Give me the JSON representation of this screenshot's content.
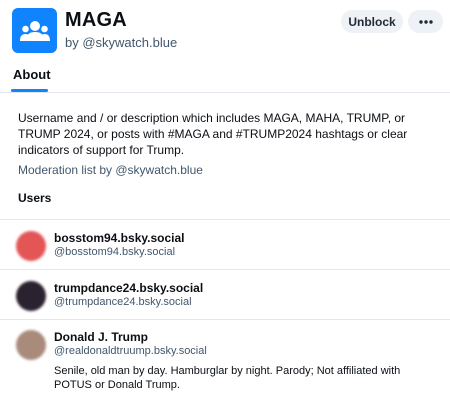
{
  "list": {
    "title": "MAGA",
    "byline": "by @skywatch.blue",
    "icon": "people-group-icon",
    "accent_color": "#1083fe"
  },
  "actions": {
    "unblock_label": "Unblock",
    "more_label": "•••"
  },
  "tabs": [
    {
      "label": "About",
      "active": true
    }
  ],
  "about": {
    "description": "Username and / or description which includes MAGA, MAHA, TRUMP, or TRUMP 2024, or posts with #MAGA and #TRUMP2024 hashtags or clear indicators of support for Trump.",
    "moderation": "Moderation list by @skywatch.blue",
    "users_heading": "Users"
  },
  "users": [
    {
      "display_name": "bosstom94.bsky.social",
      "handle": "@bosstom94.bsky.social",
      "bio": "",
      "avatar_color": "#e45656"
    },
    {
      "display_name": "trumpdance24.bsky.social",
      "handle": "@trumpdance24.bsky.social",
      "bio": "",
      "avatar_color": "#2b2230"
    },
    {
      "display_name": "Donald J. Trump",
      "handle": "@realdonaldtruump.bsky.social",
      "bio": "Senile, old man by day. Hamburglar by night. Parody; Not affiliated with POTUS or Donald Trump.",
      "avatar_color": "#a98b7c"
    }
  ]
}
